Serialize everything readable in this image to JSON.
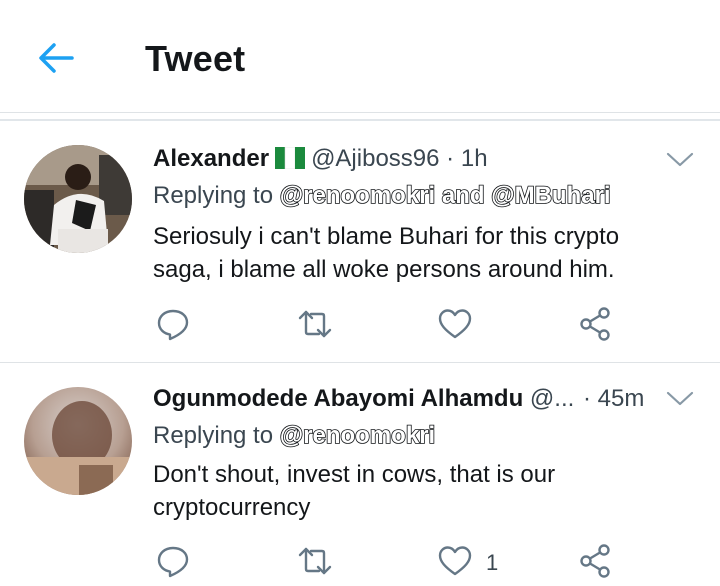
{
  "header": {
    "title": "Tweet",
    "back_icon": "arrow-left-icon",
    "accent": "#1da1f2"
  },
  "tweets": [
    {
      "display_name": "Alexander",
      "flag_icon": "nigeria-flag-icon",
      "handle": "@Ajiboss96",
      "separator": "·",
      "time": "1h",
      "replying_prefix": "Replying to ",
      "replying_to": "@renoomokri and @MBuhari",
      "text_line1": "Seriosuly i can't blame Buhari for this crypto",
      "text_line2": "saga, i blame all woke persons around him.",
      "like_count": ""
    },
    {
      "display_name": "Ogunmodede Abayomi Alhamdu",
      "handle": "@...",
      "separator": "·",
      "time": "45m",
      "replying_prefix": "Replying to ",
      "replying_to": "@renoomokri",
      "text_line1": "Don't shout, invest in cows, that is our",
      "text_line2": "cryptocurrency",
      "like_count": "1"
    }
  ]
}
